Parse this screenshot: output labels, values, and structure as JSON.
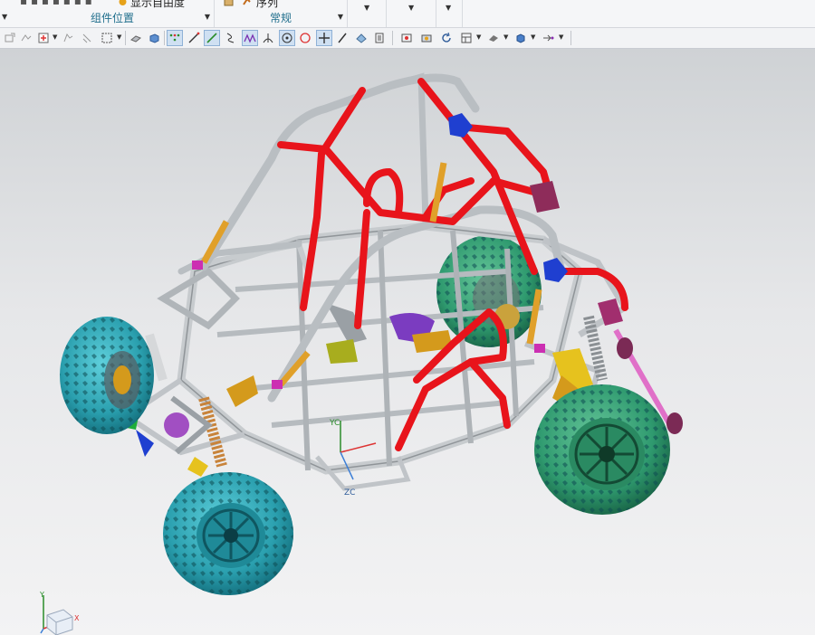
{
  "ribbon": {
    "groups": [
      {
        "label": "组件位置"
      },
      {
        "label": "常规"
      }
    ],
    "show_dof_label": "显示自由度",
    "sequence_label": "序列"
  },
  "toolbar": {
    "icons": [
      "constraint-icon",
      "move-icon",
      "snap-icon",
      "assembly-icon",
      "align-icon",
      "select-box-icon",
      "shaded-icon",
      "solid-icon",
      "points-icon",
      "line-icon",
      "sketch-line-icon",
      "curve-icon",
      "spline-icon",
      "angle-icon",
      "circle-center-icon",
      "circle-point-icon",
      "cross-icon",
      "slash-icon",
      "view-icon",
      "list-icon",
      "fit-view-icon",
      "camera-icon",
      "refresh-icon",
      "layout-icon",
      "render-icon",
      "cube-icon",
      "arrow-icon"
    ]
  },
  "viewport": {
    "axis_labels": {
      "yc": "YC",
      "zc": "ZC",
      "triad_x": "X",
      "triad_y": "Y"
    },
    "colors": {
      "roll_cage": "#e8141b",
      "frame": "#c7cbce",
      "tire_blue": "#2aa7b5",
      "tire_green": "#2f9a6f",
      "shock_gold": "#d99a1c",
      "mount_blue": "#1f3fd0",
      "accent_magenta": "#cc2fb2"
    }
  }
}
